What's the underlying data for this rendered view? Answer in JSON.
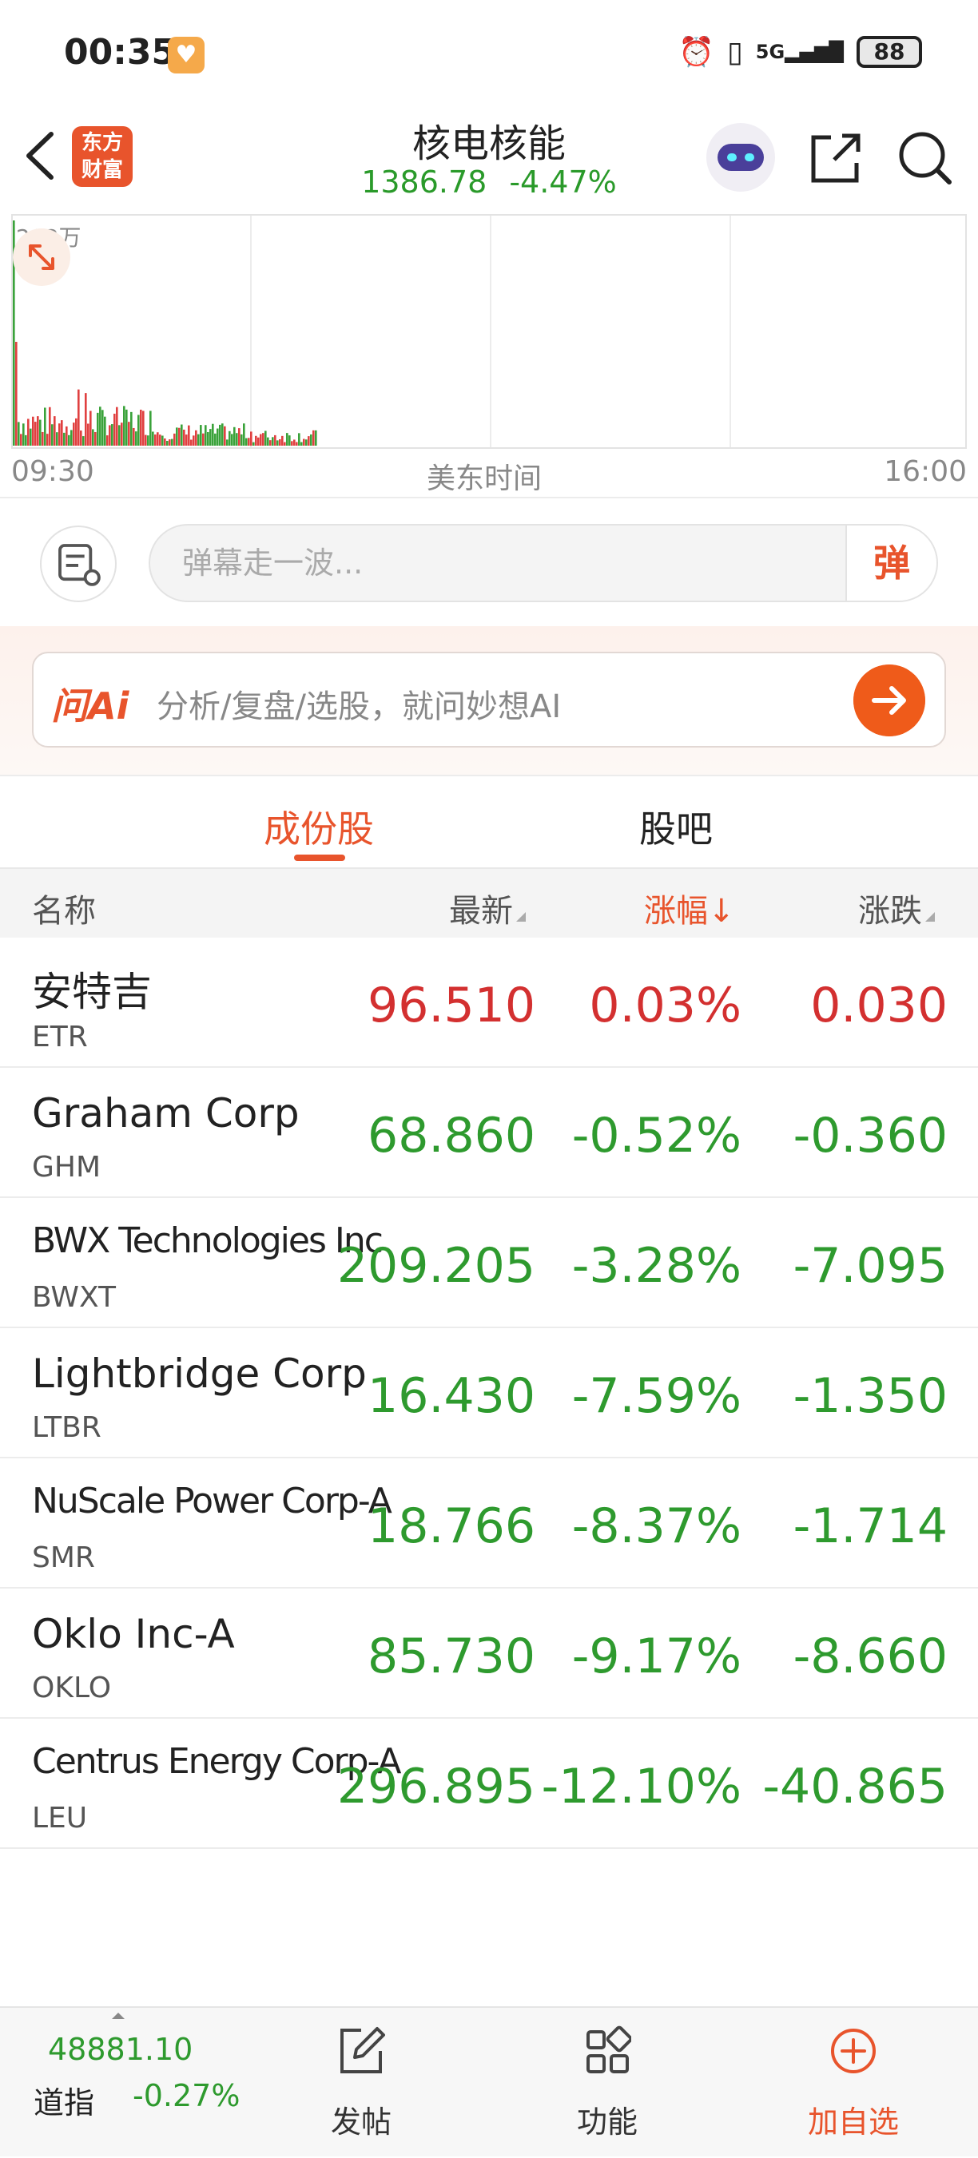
{
  "status_bar": {
    "time": "00:35",
    "network": "5G",
    "battery": "88"
  },
  "header": {
    "title": "核电核能",
    "price": "1386.78",
    "change_pct": "-4.47%",
    "logo_line1": "东方",
    "logo_line2": "财富"
  },
  "chart": {
    "ymax_label": "203万",
    "x_start": "09:30",
    "x_mid": "美东时间",
    "x_end": "16:00",
    "colors": {
      "up": "#e04040",
      "down": "#3aa23a"
    }
  },
  "danmu": {
    "placeholder": "弹幕走一波...",
    "send_label": "弹"
  },
  "ai": {
    "logo": "问Ai",
    "placeholder": "分析/复盘/选股，就问妙想AI"
  },
  "tabs": [
    {
      "label": "成份股"
    },
    {
      "label": "股吧"
    }
  ],
  "table": {
    "columns": {
      "name": "名称",
      "latest": "最新",
      "change_pct": "涨幅",
      "change": "涨跌"
    },
    "rows": [
      {
        "name": "安特吉",
        "code": "ETR",
        "latest": "96.510",
        "change_pct": "0.03%",
        "change": "0.030",
        "dir": "up"
      },
      {
        "name": "Graham Corp",
        "code": "GHM",
        "latest": "68.860",
        "change_pct": "-0.52%",
        "change": "-0.360",
        "dir": "down"
      },
      {
        "name": "BWX Technologies Inc",
        "code": "BWXT",
        "latest": "209.205",
        "change_pct": "-3.28%",
        "change": "-7.095",
        "dir": "down"
      },
      {
        "name": "Lightbridge Corp",
        "code": "LTBR",
        "latest": "16.430",
        "change_pct": "-7.59%",
        "change": "-1.350",
        "dir": "down"
      },
      {
        "name": "NuScale Power Corp-A",
        "code": "SMR",
        "latest": "18.766",
        "change_pct": "-8.37%",
        "change": "-1.714",
        "dir": "down"
      },
      {
        "name": "Oklo Inc-A",
        "code": "OKLO",
        "latest": "85.730",
        "change_pct": "-9.17%",
        "change": "-8.660",
        "dir": "down"
      },
      {
        "name": "Centrus Energy Corp-A",
        "code": "LEU",
        "latest": "296.895",
        "change_pct": "-12.10%",
        "change": "-40.865",
        "dir": "down"
      }
    ]
  },
  "bottom_bar": {
    "index_value": "48881.10",
    "index_name": "道指",
    "index_change": "-0.27%",
    "post_label": "发帖",
    "function_label": "功能",
    "add_label": "加自选"
  }
}
